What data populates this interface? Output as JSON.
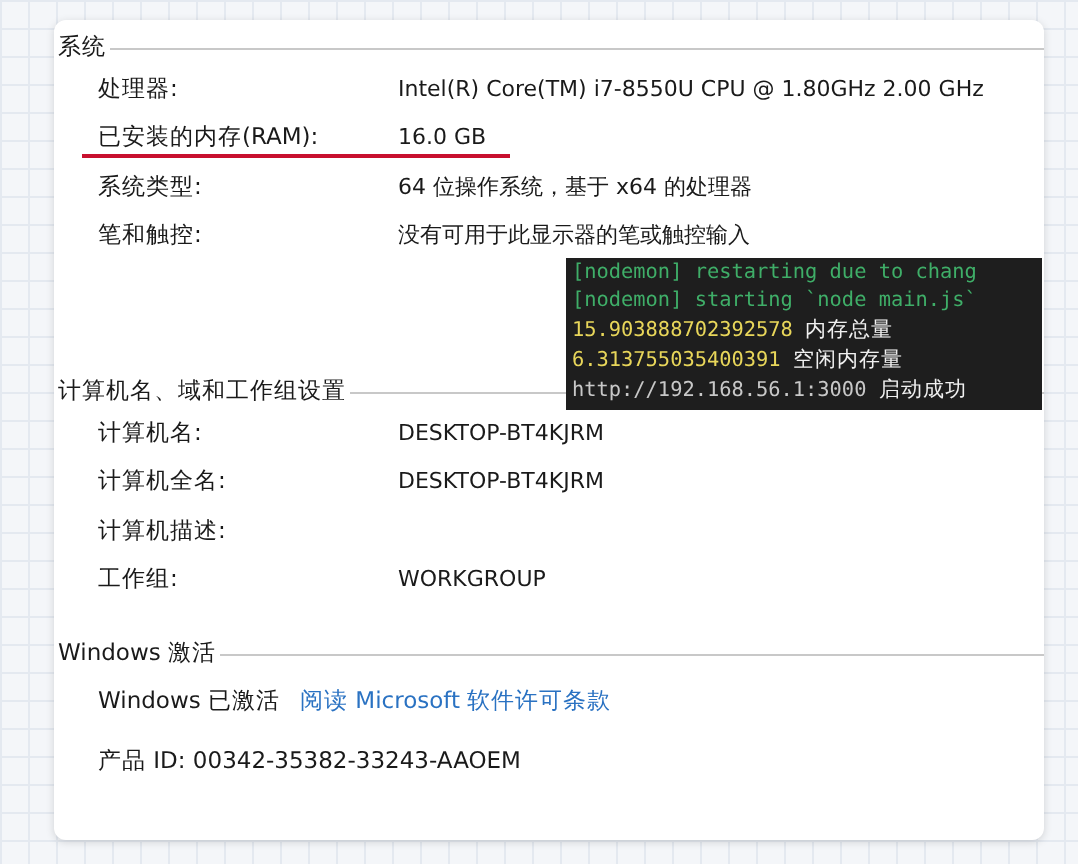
{
  "sections": [
    {
      "title": "系统",
      "rows": [
        {
          "label": "处理器:",
          "value": "Intel(R) Core(TM) i7-8550U CPU @ 1.80GHz   2.00 GHz",
          "underlined": false
        },
        {
          "label": "已安装的内存(RAM):",
          "value": "16.0 GB",
          "underlined": true
        },
        {
          "label": "系统类型:",
          "value": "64 位操作系统，基于 x64 的处理器",
          "underlined": false
        },
        {
          "label": "笔和触控:",
          "value": "没有可用于此显示器的笔或触控输入",
          "underlined": false
        }
      ]
    },
    {
      "title": "计算机名、域和工作组设置",
      "rows": [
        {
          "label": "计算机名:",
          "value": "DESKTOP-BT4KJRM",
          "underlined": false
        },
        {
          "label": "计算机全名:",
          "value": "DESKTOP-BT4KJRM",
          "underlined": false
        },
        {
          "label": "计算机描述:",
          "underlined": false
        },
        {
          "label": "工作组:",
          "value": "WORKGROUP",
          "underlined": false
        }
      ]
    }
  ],
  "terminal": {
    "lines": [
      {
        "kind": "log",
        "text": "[nodemon] restarting due to chang"
      },
      {
        "kind": "log",
        "text": "[nodemon] starting `node main.js`"
      },
      {
        "kind": "value",
        "number": "15.903888702392578",
        "text": "内存总量"
      },
      {
        "kind": "value",
        "number": "6.313755035400391",
        "text": "空闲内存量"
      },
      {
        "kind": "url",
        "number": "http://192.168.56.1:3000",
        "text": "启动成功"
      }
    ]
  },
  "activation": {
    "title": "Windows 激活",
    "status": "Windows 已激活",
    "link": "阅读 Microsoft 软件许可条款",
    "product_id": "产品 ID: 00342-35382-33243-AAOEM"
  }
}
